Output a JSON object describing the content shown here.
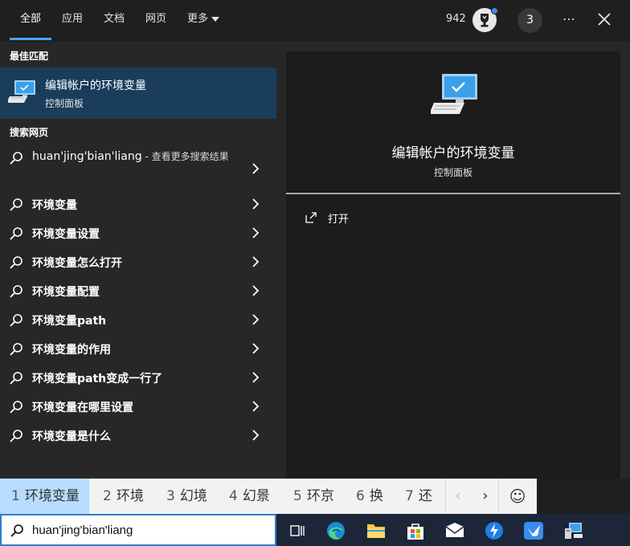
{
  "tabs": [
    {
      "label": "全部",
      "active": true
    },
    {
      "label": "应用"
    },
    {
      "label": "文档"
    },
    {
      "label": "网页"
    },
    {
      "label": "更多"
    }
  ],
  "header": {
    "points": "942",
    "badge": "3",
    "more": "⋯"
  },
  "best_match": {
    "heading": "最佳匹配",
    "title": "编辑帐户的环境变量",
    "subtitle": "控制面板"
  },
  "web_search": {
    "heading": "搜索网页",
    "first": {
      "query": "huan'jing'bian'liang",
      "suffix": " - 查看更多搜索结果"
    },
    "items": [
      "环境变量",
      "环境变量设置",
      "环境变量怎么打开",
      "环境变量配置",
      "环境变量path",
      "环境变量的作用",
      "环境变量path变成一行了",
      "环境变量在哪里设置",
      "环境变量是什么"
    ]
  },
  "preview": {
    "title": "编辑帐户的环境变量",
    "subtitle": "控制面板",
    "action_open": "打开"
  },
  "ime": {
    "candidates": [
      {
        "num": "1",
        "text": "环境变量"
      },
      {
        "num": "2",
        "text": "环境"
      },
      {
        "num": "3",
        "text": "幻境"
      },
      {
        "num": "4",
        "text": "幻景"
      },
      {
        "num": "5",
        "text": "环京"
      },
      {
        "num": "6",
        "text": "换"
      },
      {
        "num": "7",
        "text": "还"
      }
    ],
    "prev": "‹",
    "next": "›",
    "emoji": "☺"
  },
  "search_box": {
    "value": "huan'jing'bian'liang"
  },
  "colors": {
    "accent": "#4ea3f5",
    "selected_bg": "#1a3d5c",
    "ime_selected": "#b8dcff",
    "taskbar": "#1c2638"
  }
}
